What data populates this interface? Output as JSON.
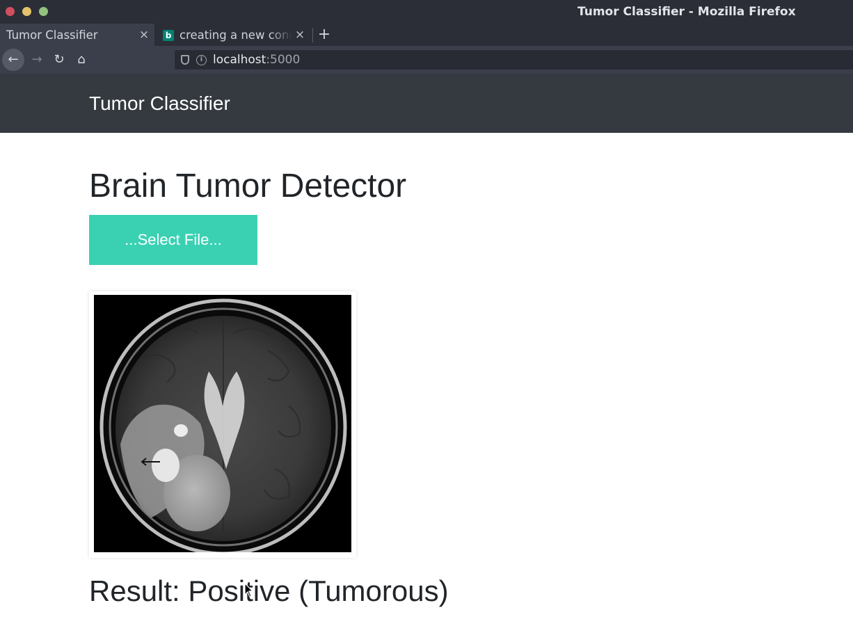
{
  "window": {
    "title": "Tumor Classifier - Mozilla Firefox"
  },
  "tabs": [
    {
      "label": "Tumor Classifier",
      "active": true,
      "close": "×"
    },
    {
      "label": "creating a new conda environment",
      "active": false,
      "icon": "bing-icon",
      "icon_glyph": "b",
      "close": "×"
    }
  ],
  "toolbar": {
    "newtab": "+",
    "back": "←",
    "forward": "→",
    "reload": "↻",
    "home": "⌂",
    "url_host": "localhost",
    "url_port": ":5000",
    "info_glyph": "i"
  },
  "navbar": {
    "brand": "Tumor Classifier",
    "background": "#343a40"
  },
  "main": {
    "heading": "Brain Tumor Detector",
    "select_button": "...Select File...",
    "button_color": "#3ad1b3",
    "preview_image": "brain MRI scan",
    "result": "Result: Positive (Tumorous)"
  }
}
